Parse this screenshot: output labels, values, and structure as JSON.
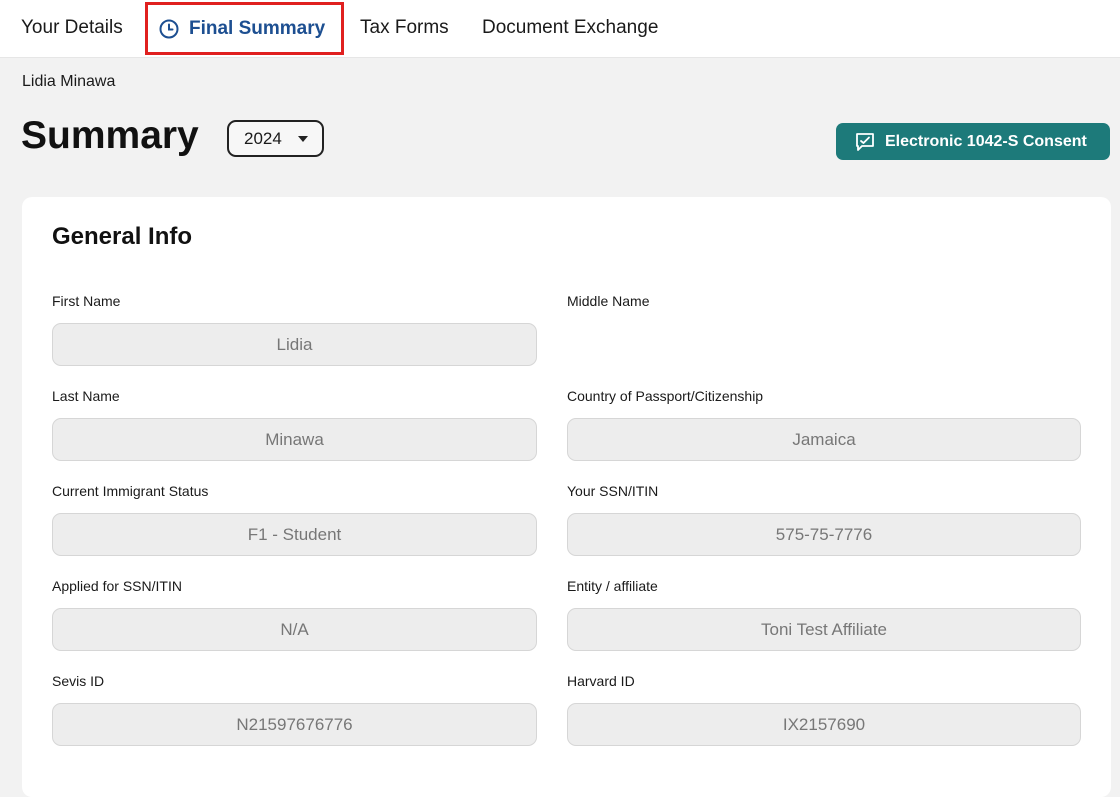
{
  "nav": {
    "tabs": [
      {
        "label": "Your Details"
      },
      {
        "label": "Final Summary",
        "icon": "clock-icon",
        "active": true
      },
      {
        "label": "Tax Forms"
      },
      {
        "label": "Document Exchange"
      }
    ]
  },
  "user": {
    "name": "Lidia Minawa"
  },
  "header": {
    "title": "Summary",
    "year": "2024",
    "consent_button": "Electronic 1042-S Consent"
  },
  "general_info": {
    "title": "General Info",
    "fields": {
      "first_name": {
        "label": "First Name",
        "value": "Lidia"
      },
      "middle_name": {
        "label": "Middle Name",
        "value": ""
      },
      "last_name": {
        "label": "Last Name",
        "value": "Minawa"
      },
      "country": {
        "label": "Country of Passport/Citizenship",
        "value": "Jamaica"
      },
      "immigrant_status": {
        "label": "Current Immigrant Status",
        "value": "F1 - Student"
      },
      "ssn": {
        "label": "Your SSN/ITIN",
        "value": "575-75-7776"
      },
      "applied_ssn": {
        "label": "Applied for SSN/ITIN",
        "value": "N/A"
      },
      "entity": {
        "label": "Entity / affiliate",
        "value": "Toni Test Affiliate"
      },
      "sevis": {
        "label": "Sevis ID",
        "value": "N21597676776"
      },
      "harvard": {
        "label": "Harvard ID",
        "value": "IX2157690"
      }
    }
  },
  "colors": {
    "accent_active_tab": "#1d4f91",
    "highlight_border": "#e0201f",
    "consent_button_bg": "#1d7a7a"
  }
}
